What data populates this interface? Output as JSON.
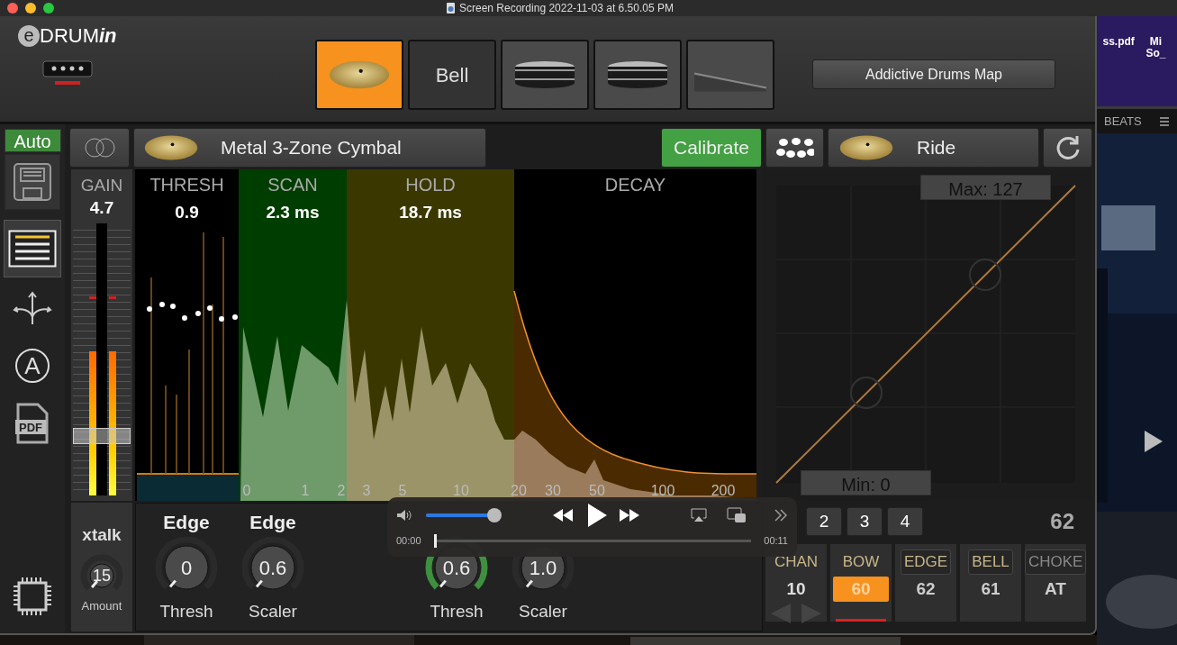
{
  "window": {
    "title": "Screen Recording 2022-11-03 at 6.50.05 PM"
  },
  "logo": {
    "mark": "e",
    "name": "DRUM",
    "suffix": "in"
  },
  "pads": [
    {
      "kind": "cymbal",
      "selected": true
    },
    {
      "kind": "text",
      "label": "Bell",
      "selected": false
    },
    {
      "kind": "drum",
      "selected": false
    },
    {
      "kind": "drum",
      "selected": false
    },
    {
      "kind": "pedal",
      "selected": false
    }
  ],
  "map_button": "Addictive Drums Map",
  "sidebar": {
    "auto": {
      "label": "Auto",
      "on": true
    },
    "items": [
      {
        "kind": "save",
        "selected": false
      },
      {
        "kind": "list",
        "selected": true
      },
      {
        "kind": "routing",
        "selected": false
      },
      {
        "kind": "auto",
        "glyph": "A",
        "selected": false
      },
      {
        "kind": "pdf",
        "glyph": "PDF",
        "selected": false
      },
      {
        "kind": "chip",
        "selected": false
      }
    ]
  },
  "preset": {
    "name": "Metal 3-Zone Cymbal"
  },
  "calibrate": "Calibrate",
  "instrument": {
    "name": "Ride"
  },
  "gain": {
    "label": "GAIN",
    "value": "4.7",
    "meter": {
      "level": 0.53
    },
    "fader": {
      "level": 0.2
    }
  },
  "envelope": {
    "sections": [
      {
        "kind": "thresh",
        "label": "THRESH",
        "value": "0.9"
      },
      {
        "kind": "scan",
        "label": "SCAN",
        "value": "2.3 ms"
      },
      {
        "kind": "hold",
        "label": "HOLD",
        "value": "18.7 ms"
      },
      {
        "kind": "decay",
        "label": "DECAY"
      }
    ],
    "ticks": [
      "0",
      "1",
      "2",
      "3",
      "5",
      "10",
      "20",
      "30",
      "50",
      "100",
      "200"
    ]
  },
  "curve": {
    "max": "Max: 127",
    "min": "Min: 0"
  },
  "xtalk": {
    "label": "xtalk",
    "value": "15",
    "caption": "Amount",
    "highlighted": false
  },
  "knobs": [
    {
      "title": "Edge",
      "value": "0",
      "caption": "Thresh",
      "highlighted": false
    },
    {
      "title": "Edge",
      "value": "0.6",
      "caption": "Scaler",
      "highlighted": false
    },
    {
      "value": "0.6",
      "caption": "Thresh",
      "highlighted": true
    },
    {
      "value": "1.0",
      "caption": "Scaler",
      "highlighted": false
    }
  ],
  "zone_tabs": [
    {
      "label": "2",
      "selected": false
    },
    {
      "label": "3",
      "selected": false
    },
    {
      "label": "4",
      "selected": false
    }
  ],
  "note": "62",
  "zones": [
    {
      "kind": "channel",
      "label": "CHAN",
      "value": "10"
    },
    {
      "kind": "zone",
      "label": "BOW",
      "value": "60",
      "selected": true
    },
    {
      "kind": "zone",
      "label": "EDGE",
      "value": "62",
      "selected": false
    },
    {
      "kind": "zone",
      "label": "BELL",
      "value": "61",
      "selected": false
    },
    {
      "kind": "zone",
      "label": "CHOKE",
      "value": "AT",
      "selected": false,
      "disabled": true
    }
  ],
  "player": {
    "volume": {
      "level": 0.95
    },
    "elapsed": "00:00",
    "remaining": "00:11",
    "progress": {
      "level": 0.0
    }
  },
  "desktop": {
    "files": [
      {
        "name": "ss.pdf"
      },
      {
        "name": "Mi So_"
      }
    ],
    "menu": "BEATS"
  }
}
